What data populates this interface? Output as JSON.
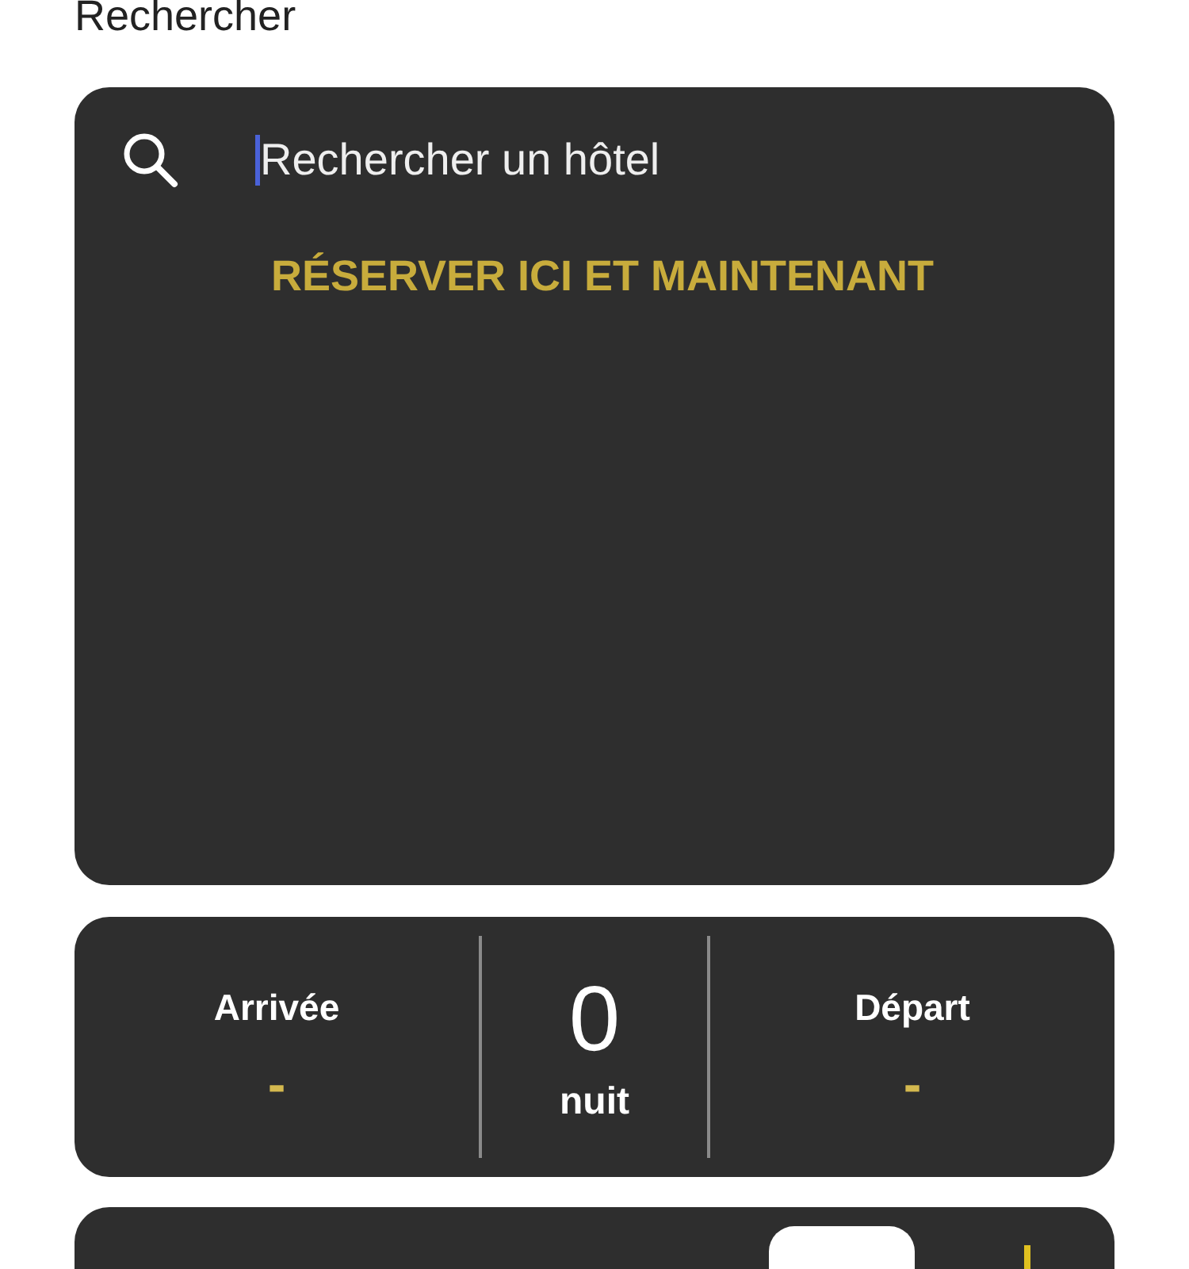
{
  "heading": "Rechercher",
  "search": {
    "placeholder": "Rechercher un hôtel",
    "focused": true
  },
  "promo": "RÉSERVER ICI ET MAINTENANT",
  "dates": {
    "arrival": {
      "label": "Arrivée",
      "value": "-"
    },
    "nights": {
      "count": "0",
      "unit": "nuit"
    },
    "departure": {
      "label": "Départ",
      "value": "-"
    }
  }
}
